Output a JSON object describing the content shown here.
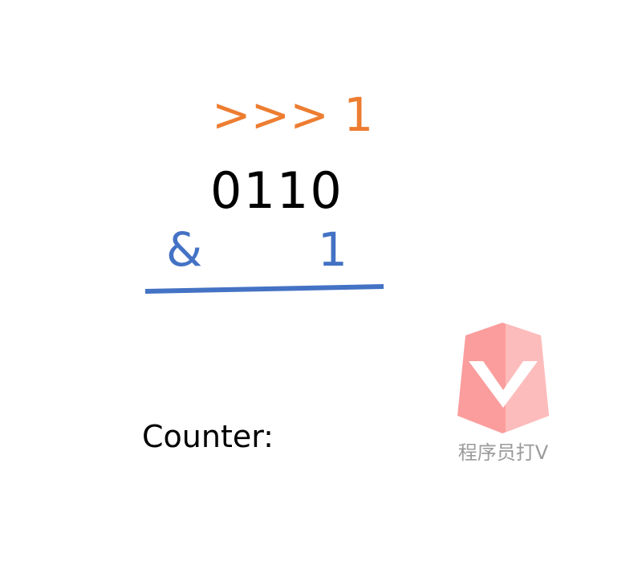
{
  "diagram": {
    "shift_operation": ">>> 1",
    "binary_value": "0110",
    "and_operator": "&",
    "mask_value": "1",
    "counter_label": "Counter:"
  },
  "watermark": {
    "logo_icon": "v-shield-icon",
    "text": "程序员打V"
  },
  "colors": {
    "shift": "#ed7d31",
    "operand": "#4472c4",
    "binary": "#000000",
    "logo": "#fb9d9d"
  }
}
